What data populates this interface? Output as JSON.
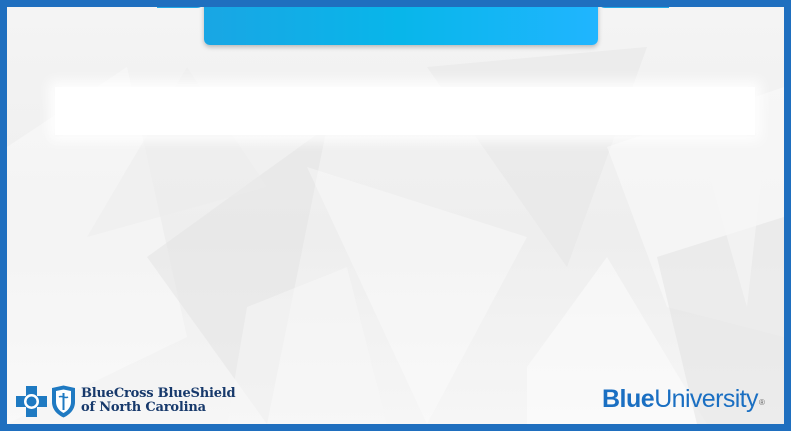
{
  "colors": {
    "frame": "#1f6fbf",
    "tab_gradient_start": "#19a6e4",
    "tab_gradient_end": "#20b5ff",
    "brand_blue": "#1a6fc2",
    "bcbs_navy": "#17396b"
  },
  "logos": {
    "bcbs": {
      "name_line1": "BlueCross BlueShield",
      "name_line2": "of North Carolina",
      "cross_icon": "bluecross-icon",
      "shield_icon": "blueshield-icon"
    },
    "blue_university": {
      "word_blue": "Blue",
      "word_university": "University",
      "trademark": "®"
    }
  }
}
